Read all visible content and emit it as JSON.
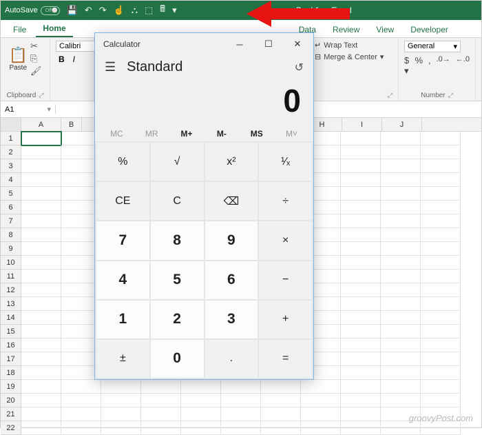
{
  "titlebar": {
    "autosave_label": "AutoSave",
    "autosave_state": "Off",
    "book": "Book1",
    "app": "Excel",
    "qat": {
      "save": "💾",
      "undo": "↶",
      "redo": "↷",
      "touch": "☝",
      "tree": "⛬",
      "shape": "⬚",
      "calc": "🖩",
      "more": "▾"
    }
  },
  "tabs": {
    "file": "File",
    "home": "Home",
    "data": "Data",
    "review": "Review",
    "view": "View",
    "developer": "Developer"
  },
  "ribbon": {
    "clipboard": {
      "paste": "Paste",
      "label": "Clipboard"
    },
    "font": {
      "name": "Calibri",
      "bold": "B",
      "italic": "I"
    },
    "align": {
      "wrap": "Wrap Text",
      "merge": "Merge & Center"
    },
    "number": {
      "format": "General",
      "label": "Number"
    }
  },
  "namebox": "A1",
  "columns": [
    "A",
    "B",
    "H",
    "I",
    "J"
  ],
  "rows": [
    1,
    2,
    3,
    4,
    5,
    6,
    7,
    8,
    9,
    10,
    11,
    12,
    13,
    14,
    15,
    16,
    17,
    18,
    19,
    20,
    21,
    22
  ],
  "calc": {
    "title": "Calculator",
    "mode": "Standard",
    "display": "0",
    "mem": {
      "mc": "MC",
      "mr": "MR",
      "mplus": "M+",
      "mminus": "M-",
      "ms": "MS",
      "mlist": "M˅"
    },
    "keys": {
      "pct": "%",
      "sqrt": "√",
      "sq": "x²",
      "inv": "¹⁄ₓ",
      "ce": "CE",
      "c": "C",
      "back": "⌫",
      "div": "÷",
      "7": "7",
      "8": "8",
      "9": "9",
      "mul": "×",
      "4": "4",
      "5": "5",
      "6": "6",
      "sub": "−",
      "1": "1",
      "2": "2",
      "3": "3",
      "add": "+",
      "neg": "±",
      "0": "0",
      "dot": ".",
      "eq": "="
    }
  },
  "watermark": "groovyPost.com"
}
